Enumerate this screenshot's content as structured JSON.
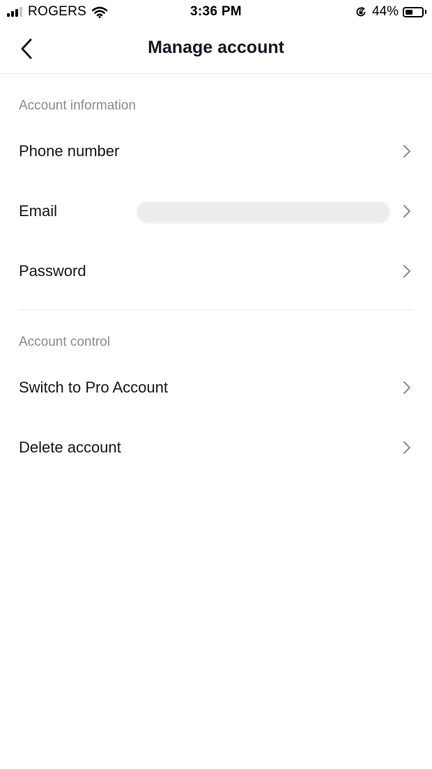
{
  "status_bar": {
    "carrier": "ROGERS",
    "time": "3:36 PM",
    "battery_percent": "44%",
    "battery_level": 0.44,
    "signal_bars_filled": 3,
    "signal_bars_total": 4,
    "icons": [
      "signal-icon",
      "wifi-icon",
      "rotation-lock-icon",
      "battery-icon"
    ]
  },
  "header": {
    "title": "Manage account",
    "back_icon": "chevron-left-icon"
  },
  "sections": [
    {
      "title": "Account information",
      "items": [
        {
          "label": "Phone number",
          "value": ""
        },
        {
          "label": "Email",
          "value": ""
        },
        {
          "label": "Password",
          "value": ""
        }
      ]
    },
    {
      "title": "Account control",
      "items": [
        {
          "label": "Switch to Pro Account"
        },
        {
          "label": "Delete account"
        }
      ]
    }
  ],
  "colors": {
    "text_primary": "#161823",
    "text_secondary": "#8a8b91",
    "divider": "#e3e3e4",
    "chevron": "#8a8b91",
    "redacted_fill": "#ececed"
  }
}
